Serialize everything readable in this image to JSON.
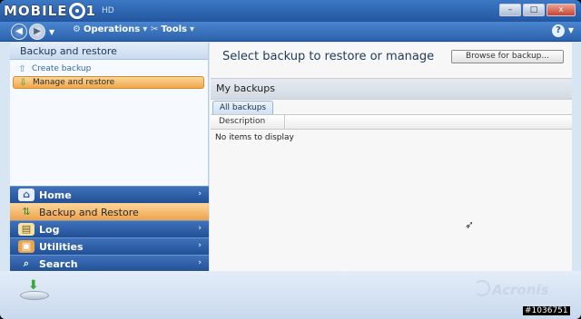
{
  "brand": {
    "text_left": "MOBILE",
    "text_right": "1",
    "suffix": "HD"
  },
  "window": {
    "minimize": "–",
    "maximize": "□",
    "close": "x"
  },
  "menubar": {
    "back_icon": "back-arrow-icon",
    "forward_icon": "forward-arrow-icon",
    "operations": "Operations",
    "tools": "Tools",
    "help": "?"
  },
  "sidebar": {
    "tasks_title": "Backup and restore",
    "tasks": [
      {
        "label": "Create backup",
        "icon": "upload-icon"
      },
      {
        "label": "Manage and restore",
        "icon": "download-icon",
        "active": true
      }
    ],
    "nav": [
      {
        "label": "Home",
        "icon": "home-icon"
      },
      {
        "label": "Backup and Restore",
        "icon": "backup-restore-icon",
        "active": true
      },
      {
        "label": "Log",
        "icon": "log-icon"
      },
      {
        "label": "Utilities",
        "icon": "utilities-icon"
      },
      {
        "label": "Search",
        "icon": "search-icon"
      }
    ]
  },
  "main": {
    "title": "Select backup to restore or manage",
    "browse_button": "Browse for backup...",
    "section_title": "My backups",
    "tab": "All backups",
    "column": "Description",
    "empty_text": "No items to display"
  },
  "footer": {
    "logo": "Acronis"
  },
  "watermark": "#1036751",
  "colors": {
    "accent": "#2d62ab",
    "active": "#f0a64b",
    "panel": "#d8e6f4"
  }
}
